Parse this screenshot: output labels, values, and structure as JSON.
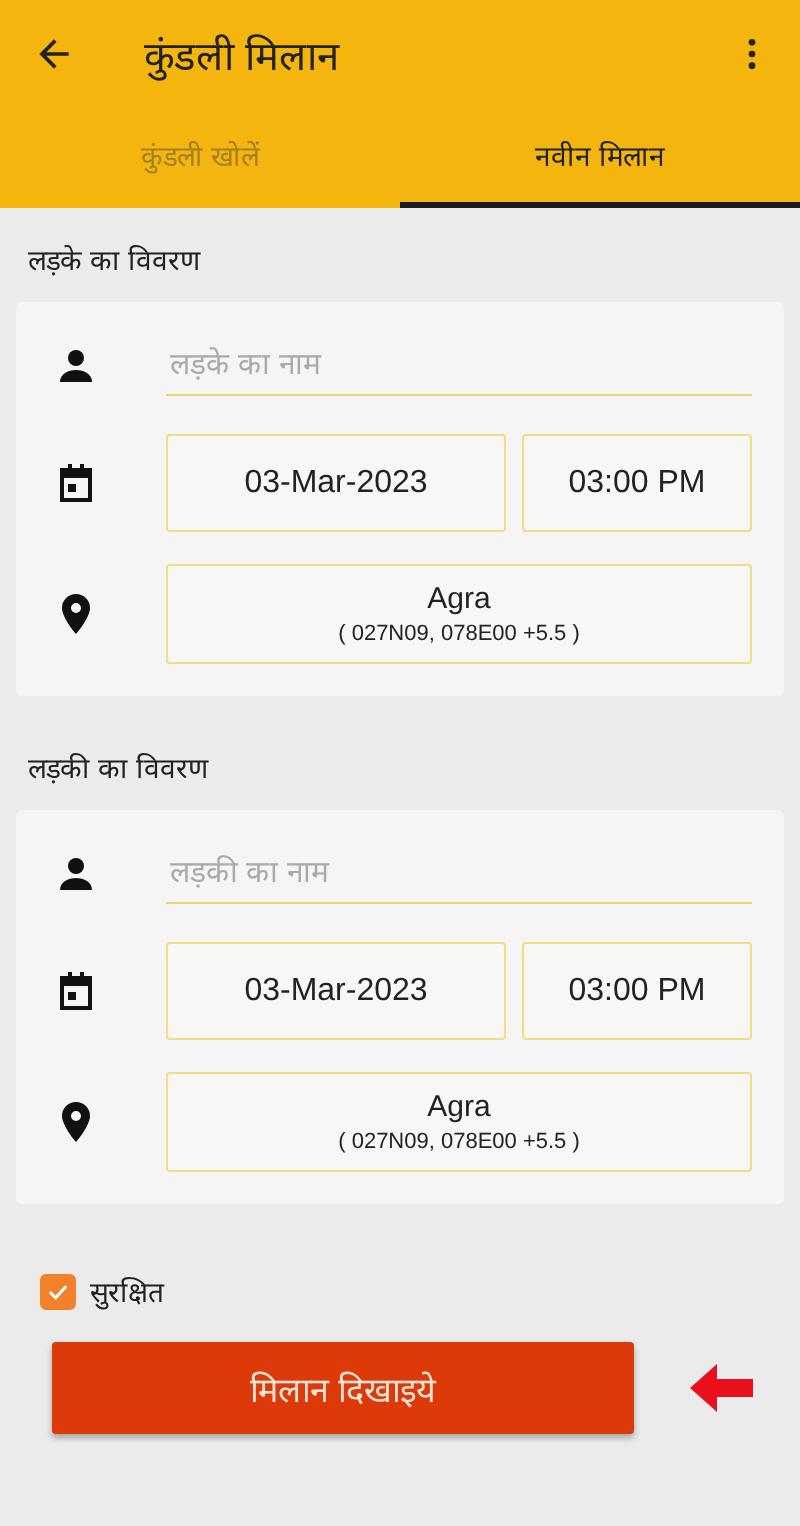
{
  "app_bar": {
    "title": "कुंडली मिलान"
  },
  "tabs": [
    {
      "label": "कुंडली खोलें",
      "selected": false
    },
    {
      "label": "नवीन मिलान",
      "selected": true
    }
  ],
  "sections": [
    {
      "heading": "लड़के का विवरण",
      "name_placeholder": "लड़के का नाम",
      "date": "03-Mar-2023",
      "time": "03:00 PM",
      "place": "Agra",
      "coordinates": "( 027N09, 078E00 +5.5 )"
    },
    {
      "heading": "लड़की का विवरण",
      "name_placeholder": "लड़की का नाम",
      "date": "03-Mar-2023",
      "time": "03:00 PM",
      "place": "Agra",
      "coordinates": "( 027N09, 078E00 +5.5 )"
    }
  ],
  "save_option": {
    "label": "सुरक्षित",
    "checked": true
  },
  "submit_button": {
    "label": "मिलान दिखाइये"
  }
}
